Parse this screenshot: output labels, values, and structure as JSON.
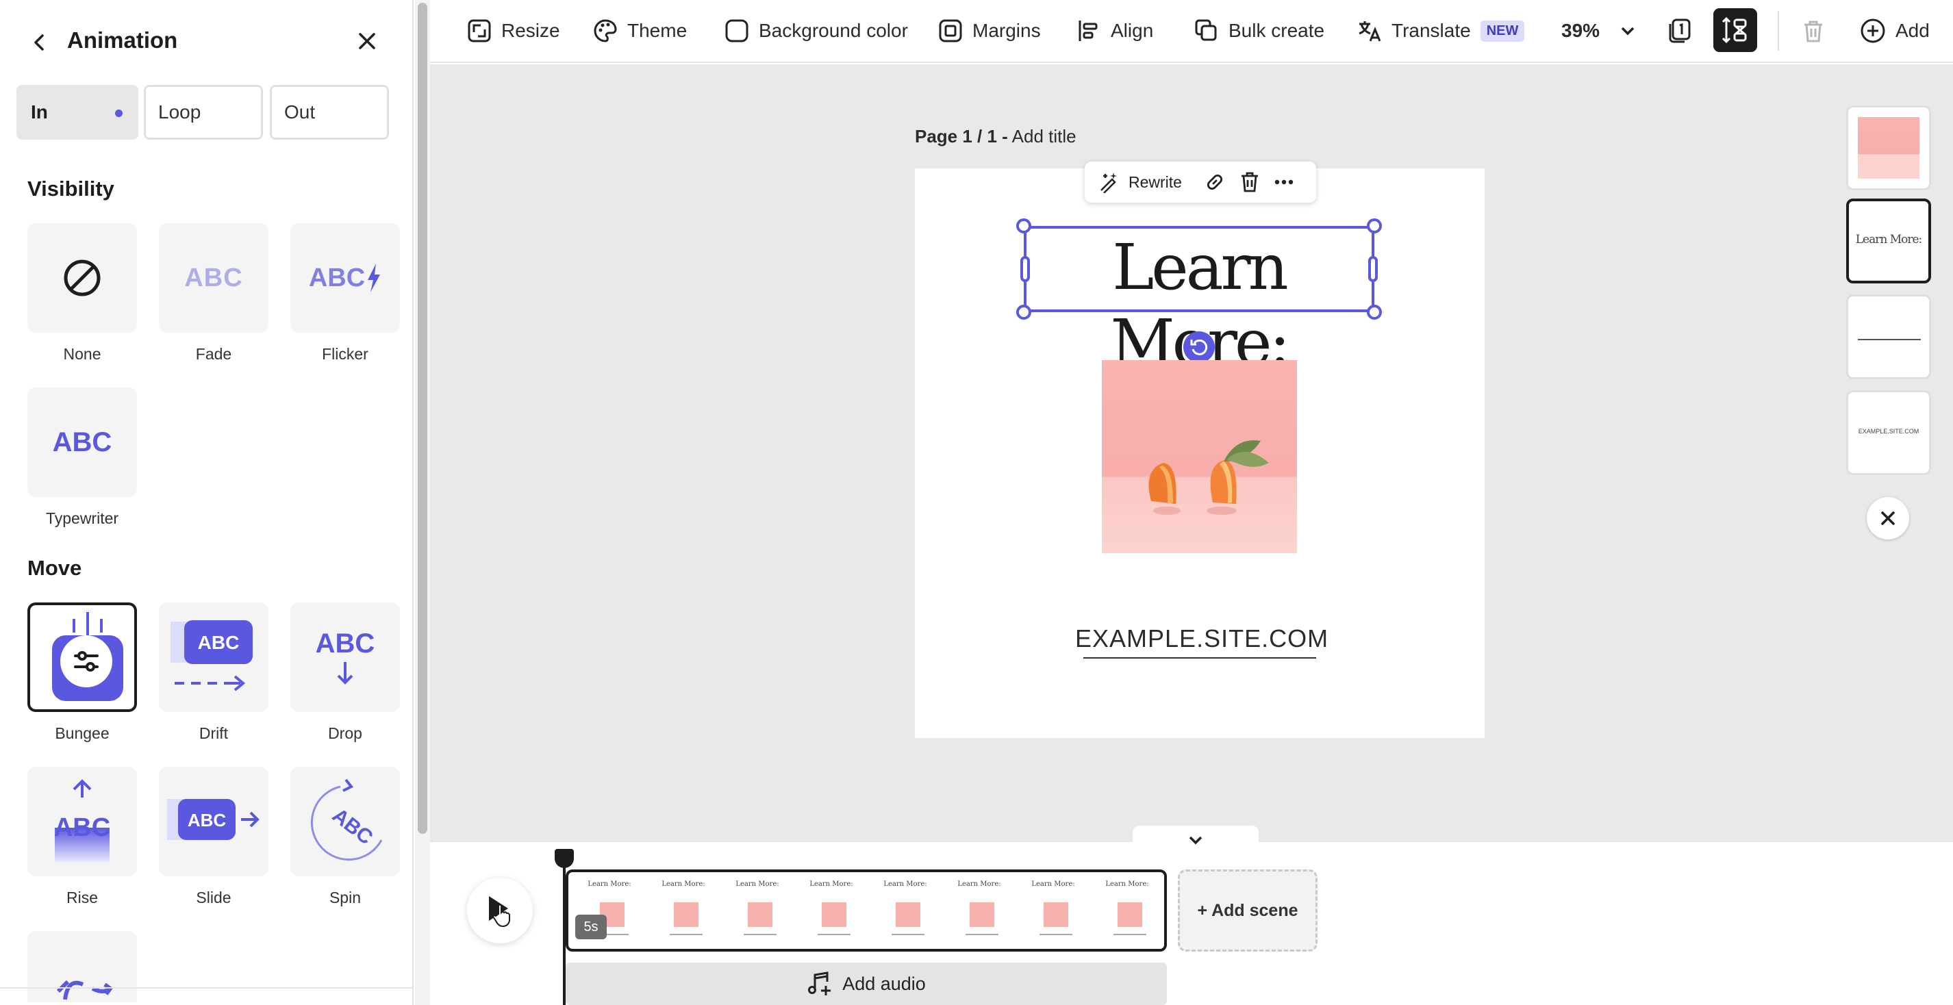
{
  "panel": {
    "title": "Animation",
    "tabs": [
      {
        "label": "In",
        "active": true
      },
      {
        "label": "Loop",
        "active": false
      },
      {
        "label": "Out",
        "active": false
      }
    ],
    "sections": {
      "visibility": {
        "title": "Visibility",
        "items": [
          {
            "label": "None",
            "icon": "none-icon"
          },
          {
            "label": "Fade",
            "icon": "fade-icon"
          },
          {
            "label": "Flicker",
            "icon": "flicker-icon"
          },
          {
            "label": "Typewriter",
            "icon": "typewriter-icon"
          }
        ]
      },
      "move": {
        "title": "Move",
        "items": [
          {
            "label": "Bungee",
            "icon": "bungee-icon",
            "selected": true
          },
          {
            "label": "Drift",
            "icon": "drift-icon"
          },
          {
            "label": "Drop",
            "icon": "drop-icon"
          },
          {
            "label": "Rise",
            "icon": "rise-icon"
          },
          {
            "label": "Slide",
            "icon": "slide-icon"
          },
          {
            "label": "Spin",
            "icon": "spin-icon"
          }
        ]
      }
    },
    "abc_text": "ABC"
  },
  "toolbar": {
    "items": [
      {
        "label": "Resize",
        "icon": "resize-icon"
      },
      {
        "label": "Theme",
        "icon": "palette-icon"
      },
      {
        "label": "Background color",
        "icon": "background-color-icon"
      },
      {
        "label": "Margins",
        "icon": "margins-icon"
      },
      {
        "label": "Align",
        "icon": "align-icon"
      },
      {
        "label": "Bulk create",
        "icon": "bulk-create-icon"
      },
      {
        "label": "Translate",
        "icon": "translate-icon",
        "badge": "NEW"
      }
    ],
    "zoom": "39%",
    "add_label": "Add"
  },
  "canvas": {
    "page_label_bold": "Page 1 / 1 -",
    "page_label_title": "Add title",
    "float_toolbar": {
      "rewrite_label": "Rewrite"
    },
    "headline": "Learn More:",
    "site_url": "EXAMPLE.SITE.COM"
  },
  "thumbnails": {
    "items": [
      {
        "kind": "image"
      },
      {
        "kind": "text",
        "text": "Learn More:"
      },
      {
        "kind": "line"
      },
      {
        "kind": "text-small",
        "text": "EXAMPLE.SITE.COM"
      }
    ]
  },
  "timeline": {
    "scene_mini_title": "Learn More:",
    "scene_count": 8,
    "duration": "5s",
    "add_scene_label": "+ Add scene",
    "add_audio_label": "Add audio"
  },
  "colors": {
    "accent": "#5a58de",
    "selected_dark": "#1d1d1d",
    "canvas_bg": "#e9e9e9",
    "photo_pink": "#f8aeaa"
  }
}
